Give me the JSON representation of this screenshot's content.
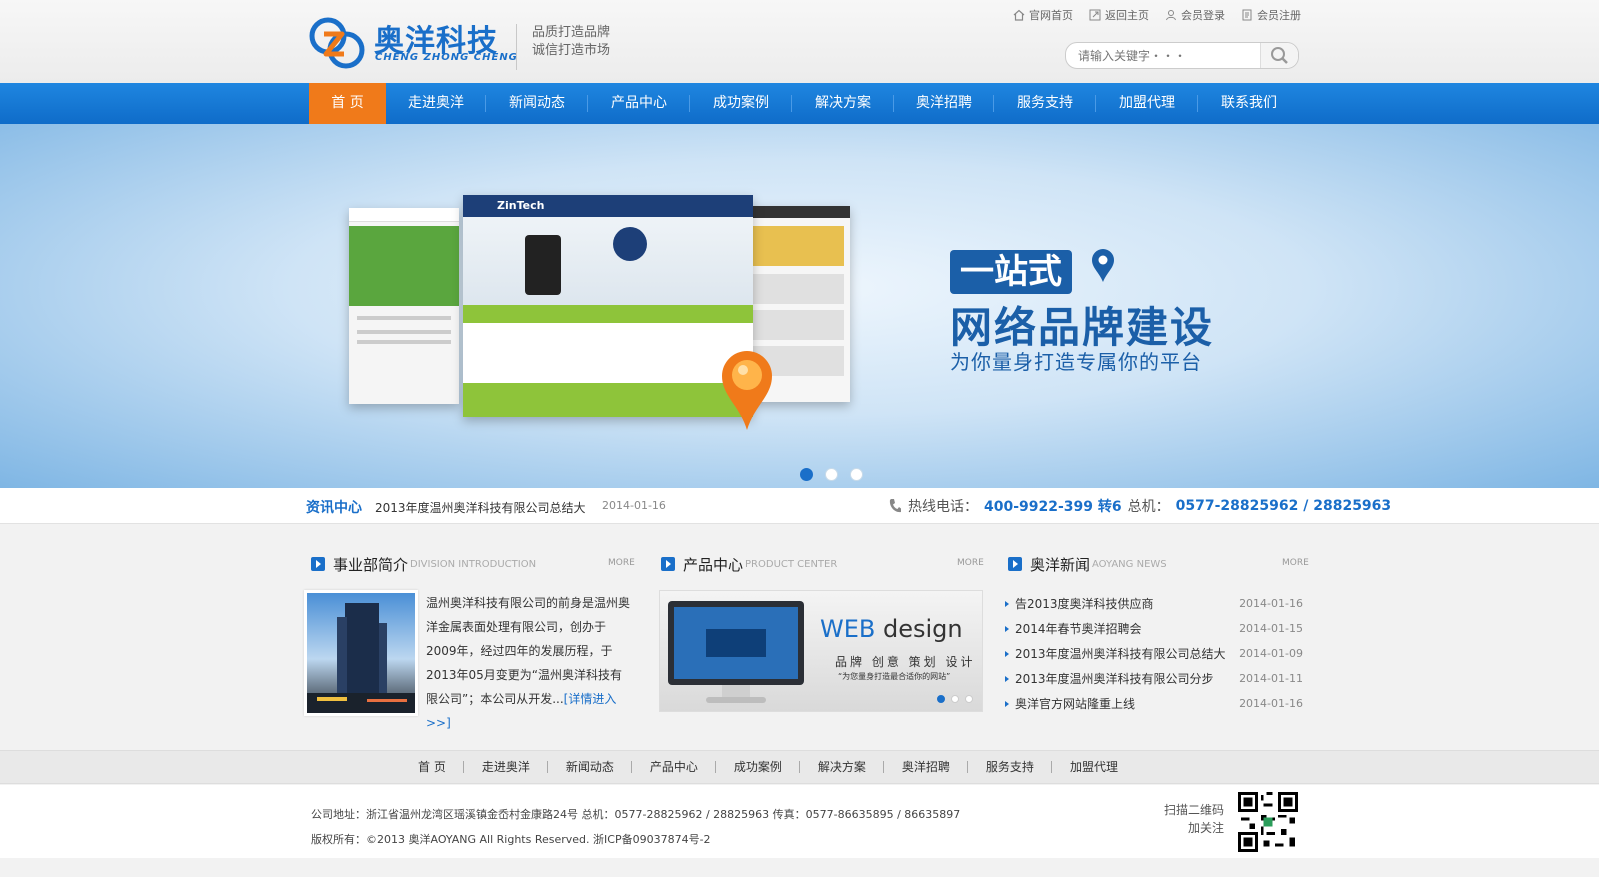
{
  "brand": {
    "name": "奥洋科技",
    "sub": "CHENG ZHONG CHENG",
    "slogan1": "品质打造品牌",
    "slogan2": "诚信打造市场",
    "colors": {
      "primary": "#1a6fc9",
      "accent": "#f07a1a"
    }
  },
  "toplinks": [
    {
      "label": "官网首页",
      "icon": "home-icon"
    },
    {
      "label": "返回主页",
      "icon": "back-icon"
    },
    {
      "label": "会员登录",
      "icon": "user-icon"
    },
    {
      "label": "会员注册",
      "icon": "register-icon"
    }
  ],
  "search": {
    "placeholder": "请输入关键字・・・"
  },
  "nav": [
    "首 页",
    "走进奥洋",
    "新闻动态",
    "产品中心",
    "成功案例",
    "解决方案",
    "奥洋招聘",
    "服务支持",
    "加盟代理",
    "联系我们"
  ],
  "banner": {
    "tag": "一站式",
    "line2": "网络品牌建设",
    "line3": "为你量身打造专属你的平台",
    "mock_brand": "ZinTech",
    "slides": 3,
    "active_slide": 1
  },
  "ticker": {
    "title": "资讯中心",
    "text": "2013年度温州奥洋科技有限公司总结大",
    "date": "2014-01-16",
    "phone_label": "热线电话：",
    "phone": "400-9922-399 转6",
    "main_label": "总机：",
    "main": "0577-28825962 / 28825963"
  },
  "division": {
    "title": "事业部简介",
    "en": "DIVISION INTRODUCTION",
    "more": "MORE",
    "text": "温州奥洋科技有限公司的前身是温州奥洋金属表面处理有限公司，创办于2009年，经过四年的发展历程，于2013年05月变更为“温州奥洋科技有限公司”；本公司从开发...",
    "link": "[详情进入>>]"
  },
  "products": {
    "title": "产品中心",
    "en": "PRODUCT CENTER",
    "more": "MORE",
    "web": "WEB",
    "design": "design",
    "sub": "品牌 创意 策划 设计",
    "sub2": "“为您量身打造最合适你的网站”",
    "slides": 3,
    "active_slide": 1
  },
  "news": {
    "title": "奥洋新闻",
    "en": "AOYANG NEWS",
    "more": "MORE",
    "items": [
      {
        "title": "告2013度奥洋科技供应商",
        "date": "2014-01-16"
      },
      {
        "title": "2014年春节奥洋招聘会",
        "date": "2014-01-15"
      },
      {
        "title": "2013年度温州奥洋科技有限公司总结大",
        "date": "2014-01-09"
      },
      {
        "title": "2013年度温州奥洋科技有限公司分步",
        "date": "2014-01-11"
      },
      {
        "title": "奥洋官方网站隆重上线",
        "date": "2014-01-16"
      }
    ]
  },
  "footer_nav": [
    "首 页",
    "走进奥洋",
    "新闻动态",
    "产品中心",
    "成功案例",
    "解决方案",
    "奥洋招聘",
    "服务支持",
    "加盟代理"
  ],
  "footer": {
    "address": "公司地址：浙江省温州龙湾区瑶溪镇金岙村金康路24号 总机：0577-28825962 / 28825963 传真：0577-86635895 / 86635897",
    "copyright": "版权所有：©2013 奥洋AOYANG All Rights Reserved. 浙ICP备09037874号-2",
    "qr1": "扫描二维码",
    "qr2": "加关注"
  }
}
